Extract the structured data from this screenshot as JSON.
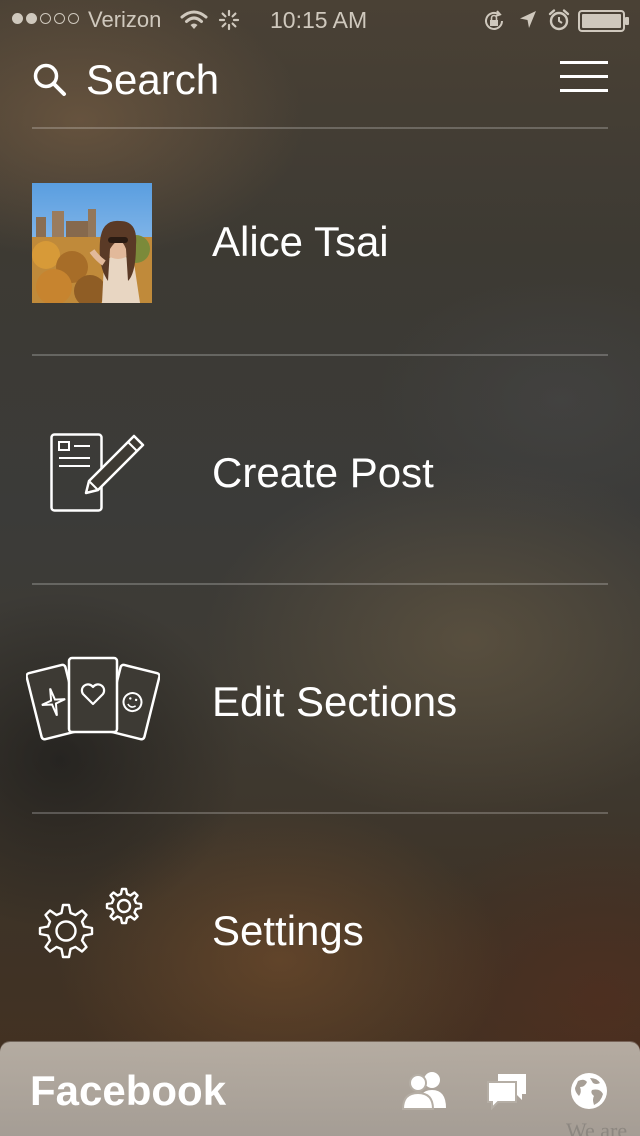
{
  "status_bar": {
    "carrier": "Verizon",
    "time": "10:15 AM",
    "signal_bars_filled": 2,
    "signal_bars_total": 5,
    "icons": [
      "wifi-icon",
      "activity-icon",
      "rotation-lock-icon",
      "location-icon",
      "alarm-icon",
      "battery-icon"
    ]
  },
  "header": {
    "search_label": "Search",
    "menu_icon": "hamburger-menu-icon"
  },
  "menu": {
    "items": [
      {
        "label": "Alice Tsai",
        "icon": "profile-photo"
      },
      {
        "label": "Create Post",
        "icon": "create-post-icon"
      },
      {
        "label": "Edit Sections",
        "icon": "edit-sections-cards-icon"
      },
      {
        "label": "Settings",
        "icon": "gears-icon"
      }
    ]
  },
  "bottom_bar": {
    "brand": "Facebook",
    "icons": [
      "friends-icon",
      "messages-icon",
      "globe-icon"
    ],
    "peek_text": "We are"
  },
  "colors": {
    "text": "#ffffff",
    "status_text": "#cfc8bd",
    "bottom_bar": "#bab3aa"
  }
}
